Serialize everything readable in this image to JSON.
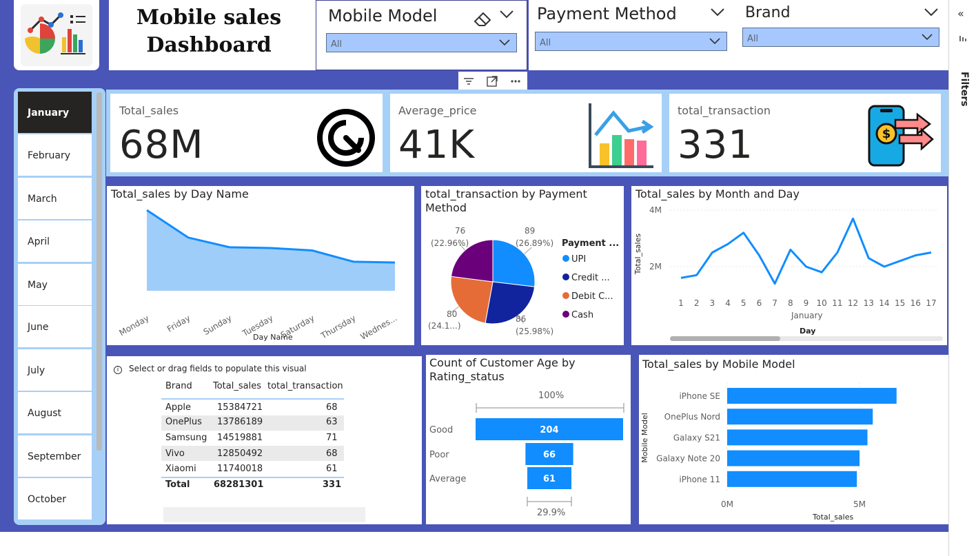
{
  "header": {
    "title_line1": "Mobile sales",
    "title_line2": "Dashboard",
    "logo_icon": "dashboard-analytics-icon"
  },
  "slicers": [
    {
      "title": "Mobile Model",
      "value": "All"
    },
    {
      "title": "Payment Method",
      "value": "All"
    },
    {
      "title": "Brand",
      "value": "All"
    }
  ],
  "filters_pane": {
    "label": "Filters"
  },
  "months": [
    "January",
    "February",
    "March",
    "April",
    "May",
    "June",
    "July",
    "August",
    "September",
    "October"
  ],
  "selected_month": "January",
  "cards": [
    {
      "label": "Total_sales",
      "value": "68M",
      "icon": "speedometer-icon"
    },
    {
      "label": "Average_price",
      "value": "41K",
      "icon": "growth-chart-icon"
    },
    {
      "label": "total_transaction",
      "value": "331",
      "icon": "mobile-payment-icon"
    }
  ],
  "day_chart": {
    "title": "Total_sales by Day Name",
    "xlabel": "Day Name"
  },
  "pie_chart": {
    "title_line1": "total_transaction by Payment",
    "title_line2": "Method",
    "legend_title": "Payment ...",
    "labels": [
      {
        "count": "89",
        "pct": "(26.89%)"
      },
      {
        "count": "86",
        "pct": "(25.98%)"
      },
      {
        "count": "80",
        "pct": "(24.1...)"
      },
      {
        "count": "76",
        "pct": "(22.96%)"
      }
    ],
    "legend": [
      "UPI",
      "Credit ...",
      "Debit C...",
      "Cash"
    ]
  },
  "month_day_chart": {
    "title": "Total_sales by Month and Day",
    "ylabel": "Total_sales",
    "month_label": "January",
    "xlabel": "Day"
  },
  "table": {
    "notice": "Select or drag fields to populate this visual",
    "headers": [
      "Brand",
      "Total_sales",
      "total_transaction"
    ],
    "rows": [
      [
        "Apple",
        "15384721",
        "68"
      ],
      [
        "OnePlus",
        "13786189",
        "63"
      ],
      [
        "Samsung",
        "14519881",
        "71"
      ],
      [
        "Vivo",
        "12850492",
        "68"
      ],
      [
        "Xiaomi",
        "11740018",
        "61"
      ]
    ],
    "total": [
      "Total",
      "68281301",
      "331"
    ]
  },
  "funnel": {
    "title_line1": "Count of Customer Age by",
    "title_line2": "Rating_status",
    "top_pct": "100%",
    "bottom_pct": "29.9%"
  },
  "model_chart": {
    "title": "Total_sales by Mobile Model",
    "ylabel": "Mobile Model",
    "xlabel": "Total_sales"
  },
  "colors": {
    "canvas": "#4a55b8",
    "accent_blue": "#118dff",
    "navy": "#12239e",
    "orange": "#e66c37",
    "purple": "#6b007b",
    "area_fill": "#9fcdfa",
    "slicer_fill": "#a6c8ff"
  },
  "chart_data": [
    {
      "type": "area",
      "title": "Total_sales by Day Name",
      "xlabel": "Day Name",
      "categories": [
        "Monday",
        "Friday",
        "Sunday",
        "Tuesday",
        "Saturday",
        "Thursday",
        "Wednes..."
      ],
      "values": [
        100,
        66,
        54,
        53,
        50,
        36,
        35
      ]
    },
    {
      "type": "pie",
      "title": "total_transaction by Payment Method",
      "legend_title": "Payment ...",
      "slices": [
        {
          "name": "UPI",
          "value": 89,
          "pct": 26.89
        },
        {
          "name": "Credit ...",
          "value": 86,
          "pct": 25.98
        },
        {
          "name": "Debit C...",
          "value": 80,
          "pct": 24.1
        },
        {
          "name": "Cash",
          "value": 76,
          "pct": 22.96
        }
      ]
    },
    {
      "type": "line",
      "title": "Total_sales by Month and Day",
      "xlabel": "Day",
      "ylabel": "Total_sales",
      "x": [
        1,
        2,
        3,
        4,
        5,
        6,
        7,
        8,
        9,
        10,
        11,
        12,
        13,
        14,
        15,
        16,
        17
      ],
      "values": [
        1.6,
        1.7,
        2.5,
        2.8,
        3.2,
        2.4,
        1.4,
        2.6,
        2.0,
        1.8,
        2.5,
        3.7,
        2.3,
        2.0,
        2.2,
        2.4,
        2.5
      ],
      "yticks": [
        "2M",
        "4M"
      ],
      "ylim": [
        0,
        4.4
      ]
    },
    {
      "type": "bar",
      "title": "Count of Customer Age by Rating_status",
      "categories": [
        "Good",
        "Poor",
        "Average"
      ],
      "values": [
        204,
        66,
        61
      ]
    },
    {
      "type": "bar",
      "title": "Total_sales by Mobile Model",
      "xlabel": "Total_sales",
      "ylabel": "Mobile Model",
      "categories": [
        "iPhone SE",
        "OnePlus Nord",
        "Galaxy S21",
        "Galaxy Note 20",
        "iPhone 11"
      ],
      "values": [
        6.4,
        5.5,
        5.3,
        5.0,
        4.9
      ],
      "xticks": [
        "0M",
        "5M"
      ],
      "xlim": [
        0,
        6.4
      ]
    }
  ]
}
